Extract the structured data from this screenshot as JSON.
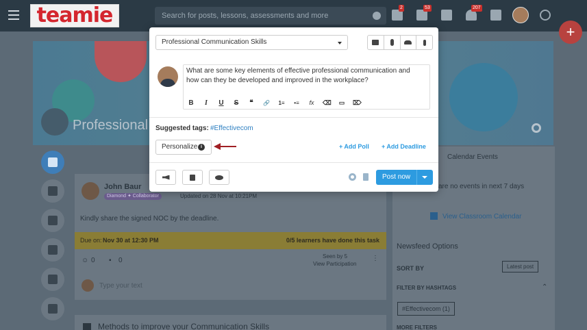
{
  "topbar": {
    "logo_text": "teamie",
    "search_placeholder": "Search for posts, lessons, assessments and more",
    "badges": [
      "2",
      "53",
      "207"
    ]
  },
  "banner": {
    "title": "Professional"
  },
  "background_feed": {
    "author": "John Baur",
    "role_badge": "Diamond ✦ Collaborator",
    "updated": "Updated on 28 Nov at 10:21PM",
    "message": "Kindly share the signed NOC by the deadline.",
    "due_label": "Due on:",
    "due_value": "Nov 30 at 12:30 PM",
    "learners_done": "0/5 learners have done this task",
    "reactions": "0",
    "comments": "0",
    "seen_by": "Seen by 5",
    "view_participation": "View Participation",
    "reply_placeholder": "Type your text",
    "next_post_title": "Methods to improve your Communication Skills"
  },
  "right_panel": {
    "calendar_title": "Calendar Events",
    "no_events": "are no events in next 7 days",
    "view_calendar": "View Classroom Calendar",
    "newsfeed_options": "Newsfeed Options",
    "sort_by": "SORT BY",
    "latest_post": "Latest post",
    "filter_by_hashtags": "FILTER BY HASHTAGS",
    "hashtag_chip": "#Effectivecom (1)",
    "more_filters": "MORE FILTERS"
  },
  "modal": {
    "course": "Professional Communication Skills",
    "post_text": "What are some key elements of effective professional communication and how can they be developed and improved in the workplace?",
    "toolbar": [
      "B",
      "I",
      "U",
      "S",
      "❝",
      "🔗",
      "1≡",
      "•≡",
      "fx",
      "⌫",
      "▭",
      "⌦"
    ],
    "suggested_tags_label": "Suggested tags:",
    "suggested_tag": "#Effectivecom",
    "personalize_label": "Personalize",
    "add_poll": "+ Add Poll",
    "add_deadline": "+ Add Deadline",
    "post_now": "Post now"
  },
  "colors": {
    "accent": "#2d9be0",
    "brand_red": "#d4262e",
    "arrow": "#a01f24"
  }
}
